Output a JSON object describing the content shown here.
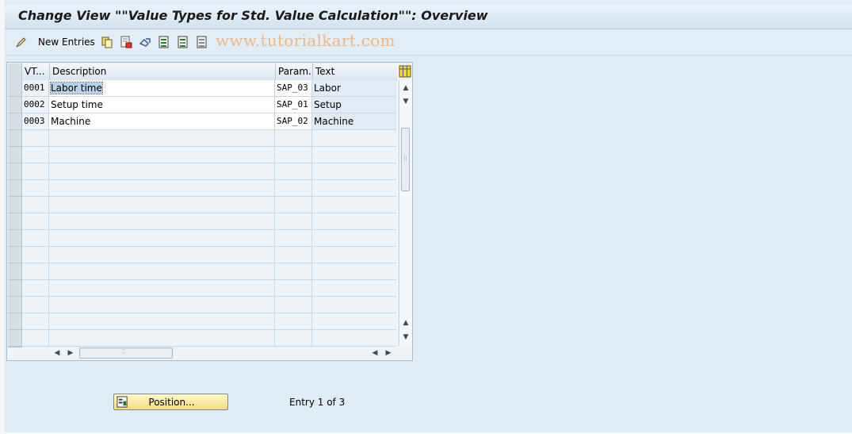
{
  "window": {
    "title": "Change View \"\"Value Types for Std. Value Calculation\"\": Overview"
  },
  "toolbar": {
    "new_entries_label": "New Entries",
    "watermark": "www.tutorialkart.com",
    "icons": [
      "edit-pencil-icon",
      "copy-icon",
      "delete-icon",
      "undo-icon",
      "select-all-icon",
      "select-block-icon",
      "deselect-all-icon"
    ]
  },
  "table": {
    "columns": [
      "VT...",
      "Description",
      "Param.",
      "Text"
    ],
    "rows": [
      {
        "vt": "0001",
        "description": "Labor time",
        "param": "SAP_03",
        "text": "Labor"
      },
      {
        "vt": "0002",
        "description": "Setup time",
        "param": "SAP_01",
        "text": "Setup"
      },
      {
        "vt": "0003",
        "description": "Machine",
        "param": "SAP_02",
        "text": "Machine"
      }
    ],
    "selected_text": "Labor time"
  },
  "footer": {
    "position_button_label": "Position...",
    "entry_info": "Entry 1 of 3"
  },
  "colors": {
    "background": "#dfebf5",
    "selection": "#b9d2ea",
    "button": "#f3dc83"
  }
}
